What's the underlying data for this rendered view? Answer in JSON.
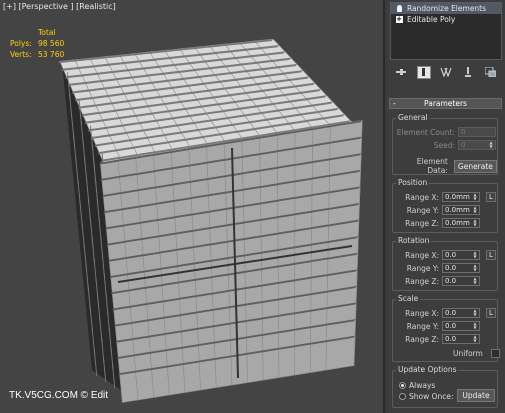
{
  "viewport": {
    "label": "[+] [Perspective ] [Realistic]",
    "stats": {
      "title": "Total",
      "polys_label": "Polys:",
      "polys_value": "98 560",
      "verts_label": "Verts:",
      "verts_value": "53 760"
    },
    "watermark": "TK.V5CG.COM © Edit"
  },
  "modifier_stack": {
    "items": [
      {
        "label": "Randomize Elements",
        "icon": "lightbulb-icon",
        "selected": true
      },
      {
        "label": "Editable Poly",
        "icon": "expand-plus-icon",
        "selected": false
      }
    ]
  },
  "toolbar": {
    "tools": [
      "pin-stack-icon",
      "show-end-result-icon",
      "make-unique-icon",
      "remove-modifier-icon",
      "configure-sets-icon"
    ]
  },
  "parameters": {
    "header": "Parameters",
    "collapse_symbol": "-",
    "general": {
      "title": "General",
      "element_count_label": "Element Count:",
      "element_count_value": "0",
      "seed_label": "Seed:",
      "seed_value": "0",
      "element_data_label": "Element Data:",
      "generate_button": "Generate"
    },
    "position": {
      "title": "Position",
      "rows": [
        {
          "label": "Range X:",
          "value": "0.0mm",
          "lock": "L"
        },
        {
          "label": "Range Y:",
          "value": "0.0mm"
        },
        {
          "label": "Range Z:",
          "value": "0.0mm"
        }
      ]
    },
    "rotation": {
      "title": "Rotation",
      "rows": [
        {
          "label": "Range X:",
          "value": "0.0",
          "lock": "L"
        },
        {
          "label": "Range Y:",
          "value": "0.0"
        },
        {
          "label": "Range Z:",
          "value": "0.0"
        }
      ]
    },
    "scale": {
      "title": "Scale",
      "rows": [
        {
          "label": "Range X:",
          "value": "0.0",
          "lock": "L"
        },
        {
          "label": "Range Y:",
          "value": "0.0"
        },
        {
          "label": "Range Z:",
          "value": "0.0"
        }
      ],
      "uniform_label": "Uniform"
    },
    "update": {
      "title": "Update Options",
      "always_label": "Always",
      "show_once_label": "Show Once:",
      "update_button": "Update",
      "selected": "always"
    }
  },
  "colors": {
    "stats_text": "#ffd100",
    "viewport_bg": "#444444",
    "cube_top": "#d9d9d9",
    "cube_left": "#bdbdbd",
    "cube_right": "#a8a8a8"
  }
}
